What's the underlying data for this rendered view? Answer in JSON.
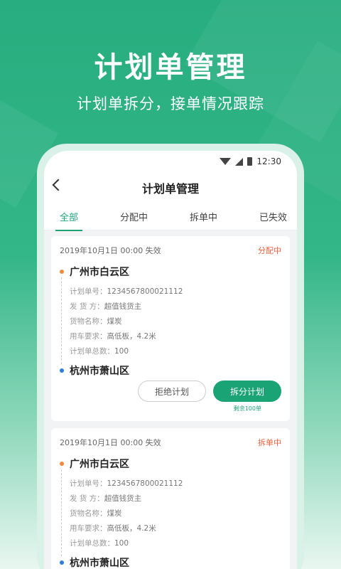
{
  "hero": {
    "title": "计划单管理",
    "subtitle": "计划单拆分，接单情况跟踪"
  },
  "statusbar": {
    "time": "12:30"
  },
  "navbar": {
    "title": "计划单管理"
  },
  "tabs": [
    {
      "label": "全部",
      "active": true
    },
    {
      "label": "分配中",
      "active": false
    },
    {
      "label": "拆单中",
      "active": false
    },
    {
      "label": "已失效",
      "active": false
    }
  ],
  "cards": [
    {
      "header": "2019年10月1日 00:00 失效",
      "status": "分配中",
      "from": "广州市白云区",
      "to": "杭州市萧山区",
      "rows": [
        {
          "k": "计划单号：",
          "v": "1234567800021112"
        },
        {
          "k": "发 货 方：",
          "v": "超值钱货主"
        },
        {
          "k": "货物名称：",
          "v": "煤炭"
        },
        {
          "k": "用车要求：",
          "v": "高低板，4.2米"
        },
        {
          "k": "计划单总数：",
          "v": "100"
        }
      ],
      "reject_label": "拒绝计划",
      "split_label": "拆分计划",
      "remain": "剩余100单"
    },
    {
      "header": "2019年10月1日 00:00 失效",
      "status": "拆单中",
      "from": "广州市白云区",
      "to": "杭州市萧山区",
      "rows": [
        {
          "k": "计划单号：",
          "v": "1234567800021112"
        },
        {
          "k": "发 货 方：",
          "v": "超值钱货主"
        },
        {
          "k": "货物名称：",
          "v": "煤炭"
        },
        {
          "k": "用车要求：",
          "v": "高低板，4.2米"
        },
        {
          "k": "计划单总数：",
          "v": "100"
        }
      ]
    }
  ]
}
